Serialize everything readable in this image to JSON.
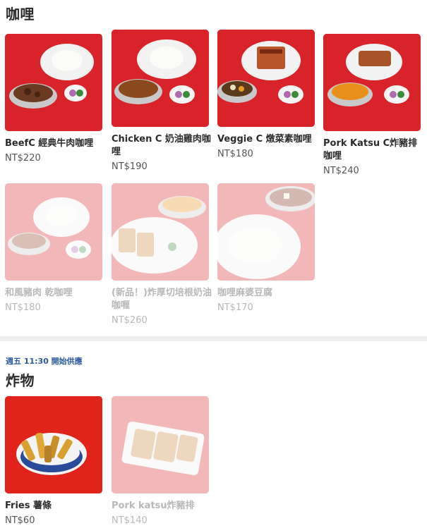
{
  "sections": [
    {
      "title": "咖哩",
      "items": [
        {
          "name": "BeefC 經典牛肉咖哩",
          "price": "NT$220",
          "available": true,
          "image": "beef-curry-photo"
        },
        {
          "name": "Chicken C 奶油雞肉咖哩",
          "price": "NT$190",
          "available": true,
          "image": "chicken-curry-photo"
        },
        {
          "name": "Veggie C 燉菜素咖哩",
          "price": "NT$180",
          "available": true,
          "image": "veggie-curry-photo"
        },
        {
          "name": "Pork Katsu C炸豬排咖哩",
          "price": "NT$240",
          "available": true,
          "image": "pork-katsu-curry-photo"
        },
        {
          "name": "和風豬肉 乾咖哩",
          "price": "NT$180",
          "available": false,
          "image": "dry-pork-curry-photo"
        },
        {
          "name": "(新品！)炸厚切培根奶油咖喱",
          "price": "NT$260",
          "available": false,
          "image": "bacon-cutlet-curry-photo"
        },
        {
          "name": "咖哩麻婆豆腐",
          "price": "NT$170",
          "available": false,
          "image": "mapo-tofu-curry-photo"
        }
      ]
    },
    {
      "schedule": "週五 11:30 開始供應",
      "title": "炸物",
      "items": [
        {
          "name": "Fries 薯條",
          "price": "NT$60",
          "available": true,
          "image": "fries-photo"
        },
        {
          "name": "Pork katsu炸豬排",
          "price": "NT$140",
          "available": false,
          "image": "pork-katsu-photo"
        }
      ]
    }
  ],
  "colors": {
    "plate_background": "#d8232a",
    "schedule_text": "#2d5a9e",
    "divider": "#eeeeee"
  }
}
